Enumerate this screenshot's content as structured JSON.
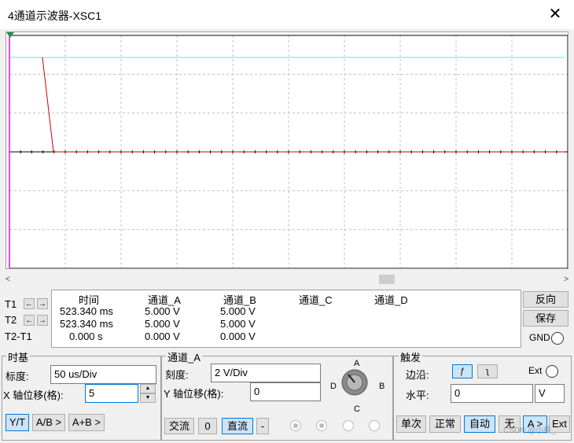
{
  "window": {
    "title": "4通道示波器-XSC1",
    "close_glyph": "✕"
  },
  "screen": {
    "colors": {
      "background": "#ffffff",
      "grid": "#c0c0c0",
      "channel_a": "#66e0e0",
      "channel_b": "#cc0000",
      "axis": "#000000",
      "cursor": "#ff00ff"
    }
  },
  "measurements": {
    "headers": [
      "时间",
      "通道_A",
      "通道_B",
      "通道_C",
      "通道_D"
    ],
    "rows": [
      {
        "label": "T1",
        "time": "523.340 ms",
        "a": "5.000 V",
        "b": "5.000 V"
      },
      {
        "label": "T2",
        "time": "523.340 ms",
        "a": "5.000 V",
        "b": "5.000 V"
      },
      {
        "label": "T2-T1",
        "time": "0.000 s",
        "a": "0.000 V",
        "b": "0.000 V"
      }
    ]
  },
  "side_buttons": {
    "reverse": "反向",
    "save": "保存",
    "gnd": "GND"
  },
  "timebase": {
    "title": "时基",
    "scale_label": "标度:",
    "scale_value": "50 us/Div",
    "x_offset_label": "X 轴位移(格):",
    "x_offset_value": "5",
    "yt": "Y/T",
    "ab": "A/B >",
    "apb": "A+B >"
  },
  "channel": {
    "title": "通道_A",
    "scale_label": "刻度:",
    "scale_value": "2  V/Div",
    "y_offset_label": "Y 轴位移(格):",
    "y_offset_value": "0",
    "knob_labels": {
      "a": "A",
      "b": "B",
      "c": "C",
      "d": "D"
    },
    "ac": "交流",
    "zero": "0",
    "dc": "直流",
    "minus": "-"
  },
  "trigger": {
    "title": "触发",
    "edge_label": "边沿:",
    "ext_label": "Ext",
    "level_label": "水平:",
    "level_value": "0",
    "level_unit": "V",
    "single": "单次",
    "normal": "正常",
    "auto": "自动",
    "none": "无",
    "a_btn": "A >",
    "ext_btn": "Ext"
  },
  "watermark": "CSDN @小桂_"
}
